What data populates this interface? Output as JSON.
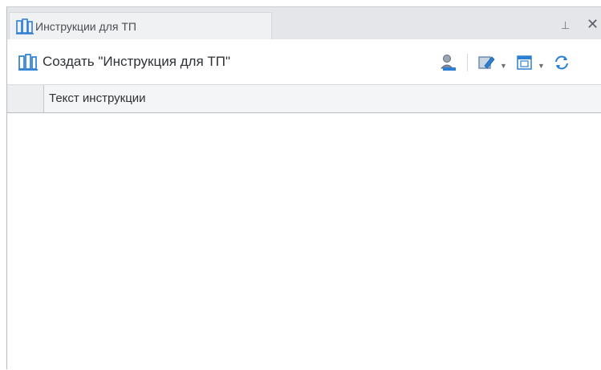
{
  "panel": {
    "tab_title": "Инструкции для ТП",
    "pin_glyph": "ᵽ",
    "close_glyph": "✕"
  },
  "toolbar": {
    "create_label": "Создать \"Инструкция для ТП\"",
    "icons": [
      "user-icon",
      "edit-icon",
      "calendar-icon",
      "refresh-icon"
    ]
  },
  "grid": {
    "columns": [
      "Текст инструкции"
    ],
    "rows": []
  },
  "colors": {
    "titlebar": "#e4e6ea",
    "tab": "#f0f1f3",
    "accent_blue": "#2d7fd3",
    "border": "#b9bcc1"
  }
}
